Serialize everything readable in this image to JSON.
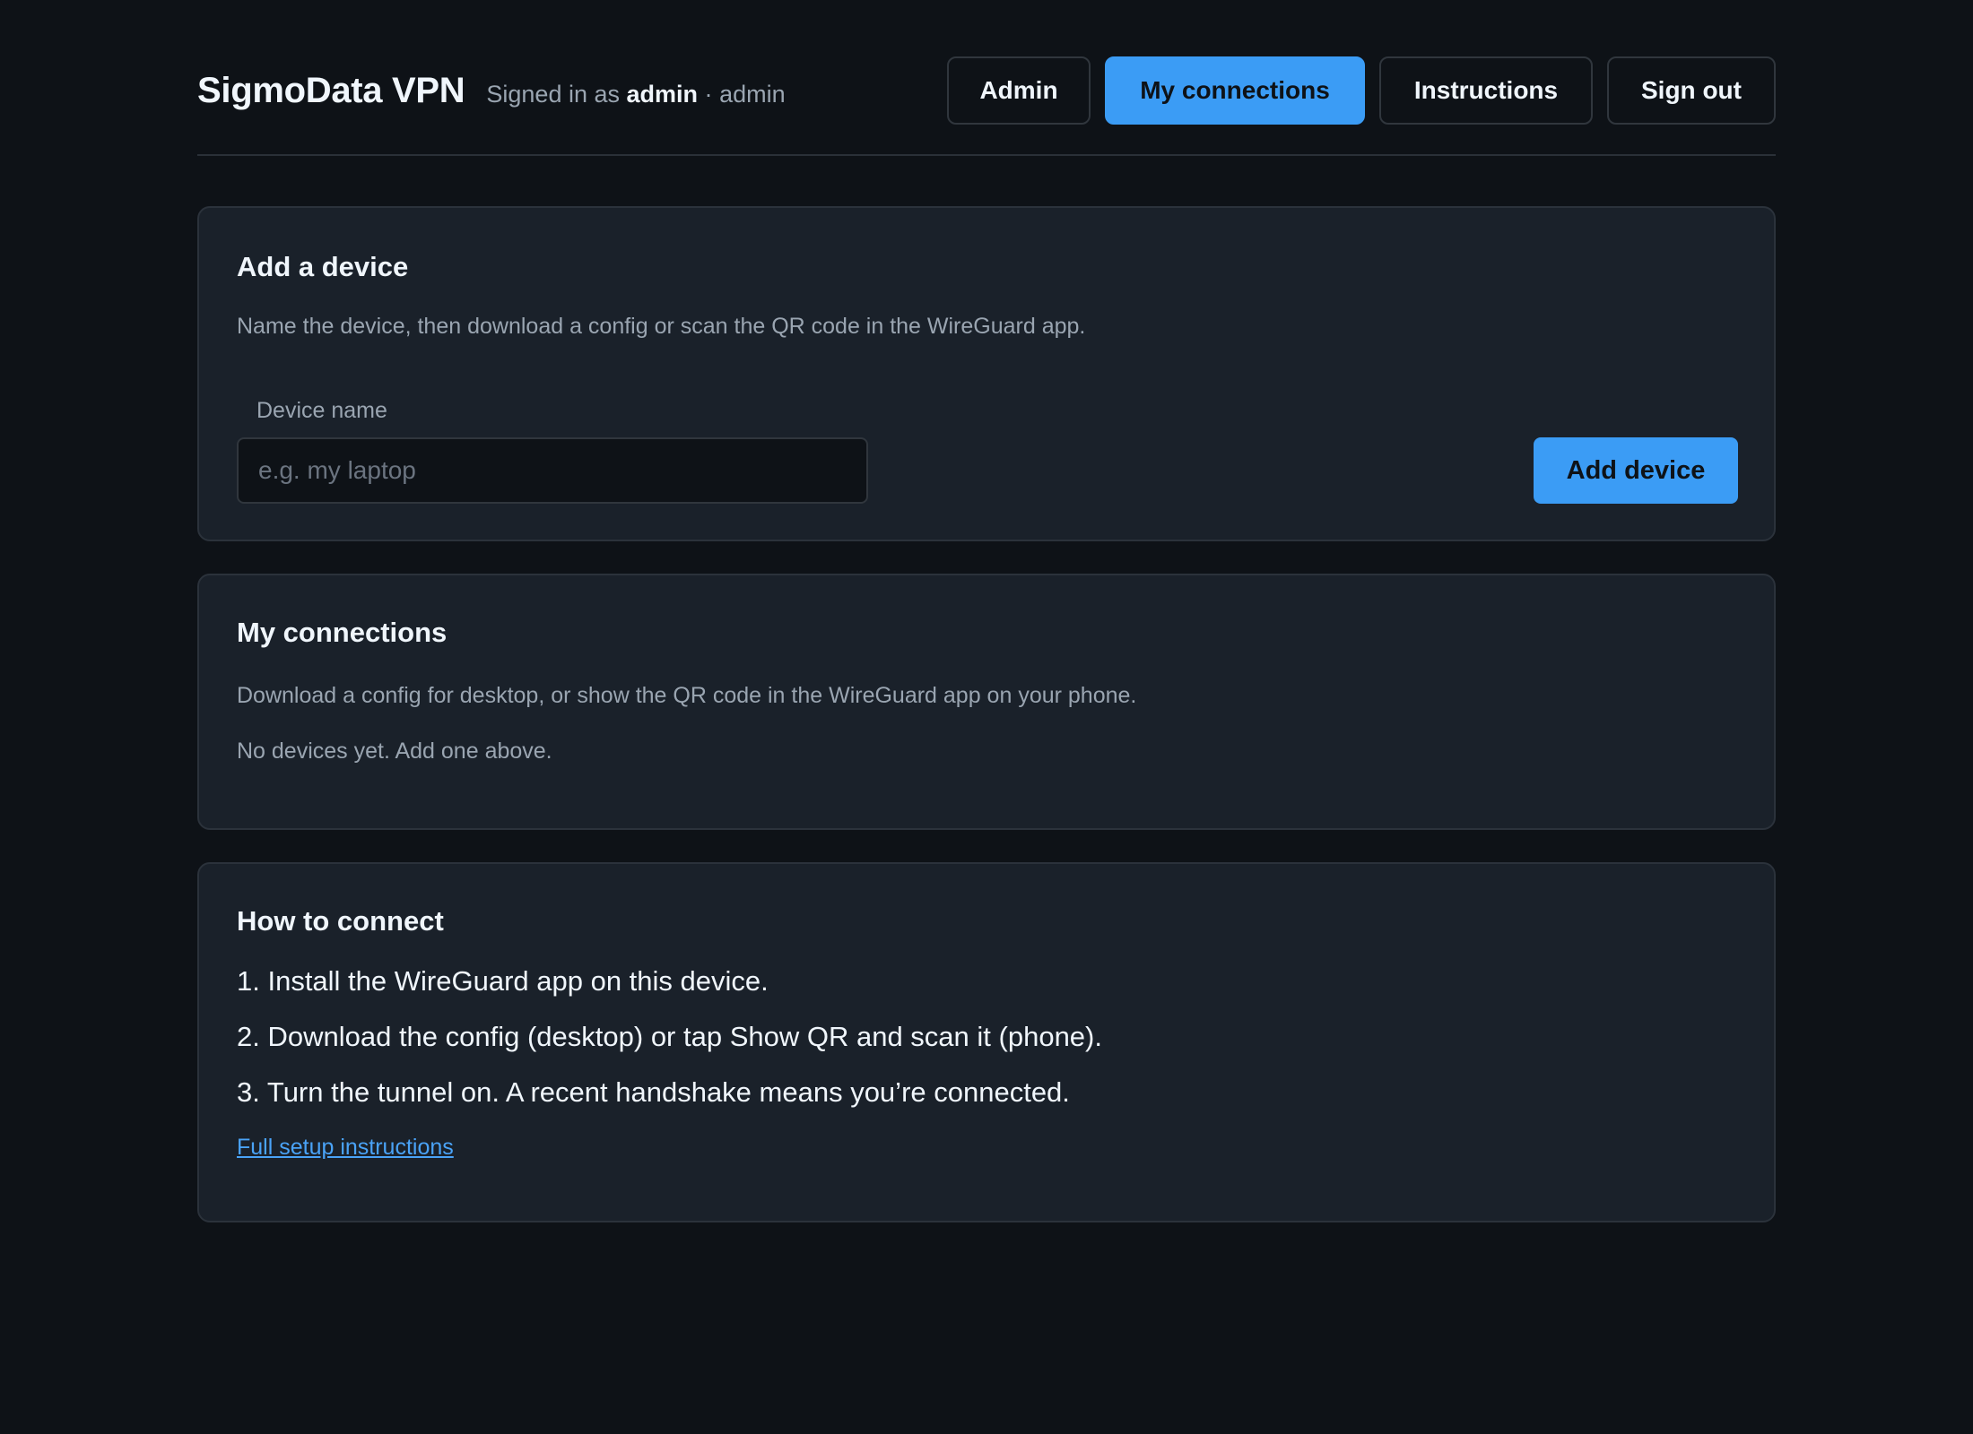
{
  "header": {
    "brand": "SigmoData VPN",
    "signed_in_prefix": "Signed in as",
    "username": "admin",
    "separator": "·",
    "role": "admin"
  },
  "nav": {
    "admin": "Admin",
    "my_connections": "My connections",
    "instructions": "Instructions",
    "sign_out": "Sign out",
    "active": "my_connections"
  },
  "add_device": {
    "title": "Add a device",
    "description": "Name the device, then download a config or scan the QR code in the WireGuard app.",
    "field_label": "Device name",
    "input_value": "",
    "input_placeholder": "e.g. my laptop",
    "button": "Add device"
  },
  "connections": {
    "title": "My connections",
    "description": "Download a config for desktop, or show the QR code in the WireGuard app on your phone.",
    "empty_message": "No devices yet. Add one above."
  },
  "how_to": {
    "title": "How to connect",
    "steps": [
      "1. Install the WireGuard app on this device.",
      "2. Download the config (desktop) or tap Show QR and scan it (phone).",
      "3. Turn the tunnel on. A recent handshake means you’re connected."
    ],
    "link": "Full setup instructions"
  },
  "colors": {
    "background": "#0e1217",
    "card": "#1a212a",
    "accent": "#3b9cf5",
    "link": "#4aa3f7"
  }
}
